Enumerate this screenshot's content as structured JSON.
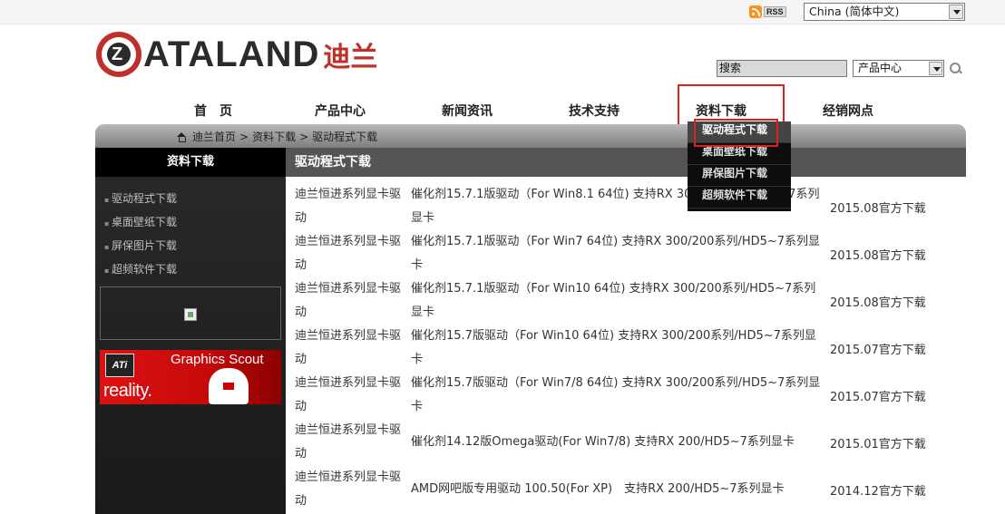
{
  "topbar": {
    "rss_label": "RSS",
    "language": "China (简体中文)"
  },
  "logo": {
    "letter": "Z",
    "text": "ATALAND",
    "cn": "迪兰"
  },
  "search": {
    "placeholder": "搜索",
    "category": "产品中心"
  },
  "nav": [
    "首　页",
    "产品中心",
    "新闻资讯",
    "技术支持",
    "资料下载",
    "经销网点"
  ],
  "breadcrumb": [
    "迪兰首页",
    "资料下载",
    "驱动程式下载"
  ],
  "breadcrumb_separator": ">",
  "sidebar": {
    "title": "资料下载",
    "items": [
      "驱动程式下载",
      "桌面壁纸下载",
      "屏保图片下载",
      "超频软件下载"
    ],
    "banner": {
      "logo": "ATi",
      "title": "Graphics Scout",
      "tagline": "reality."
    }
  },
  "content": {
    "title": "驱动程式下载",
    "rows": [
      {
        "series": "迪兰恒进系列显卡驱动",
        "title": "催化剂15.7.1版驱动（For Win8.1 64位) 支持RX 300/200系列/HD5~7系列显卡",
        "date": "2015.08官方下载"
      },
      {
        "series": "迪兰恒进系列显卡驱动",
        "title": "催化剂15.7.1版驱动（For Win7 64位) 支持RX 300/200系列/HD5~7系列显卡",
        "date": "2015.08官方下载"
      },
      {
        "series": "迪兰恒进系列显卡驱动",
        "title": "催化剂15.7.1版驱动（For Win10 64位) 支持RX 300/200系列/HD5~7系列显卡",
        "date": "2015.08官方下载"
      },
      {
        "series": "迪兰恒进系列显卡驱动",
        "title": "催化剂15.7版驱动（For Win10 64位) 支持RX 300/200系列/HD5~7系列显卡",
        "date": "2015.07官方下载"
      },
      {
        "series": "迪兰恒进系列显卡驱动",
        "title": "催化剂15.7版驱动（For Win7/8 64位) 支持RX 300/200系列/HD5~7系列显卡",
        "date": "2015.07官方下载"
      },
      {
        "series": "迪兰恒进系列显卡驱动",
        "title": "催化剂14.12版Omega驱动(For Win7/8) 支持RX 200/HD5~7系列显卡",
        "date": "2015.01官方下载"
      },
      {
        "series": "迪兰恒进系列显卡驱动",
        "title": "AMD网吧版专用驱动 100.50(For XP)　支持RX 200/HD5~7系列显卡",
        "date": "2014.12官方下载"
      }
    ]
  },
  "dropdown": {
    "items": [
      "驱动程式下载",
      "桌面壁纸下载",
      "屏保图片下载",
      "超频软件下载"
    ],
    "active_index": 0
  }
}
